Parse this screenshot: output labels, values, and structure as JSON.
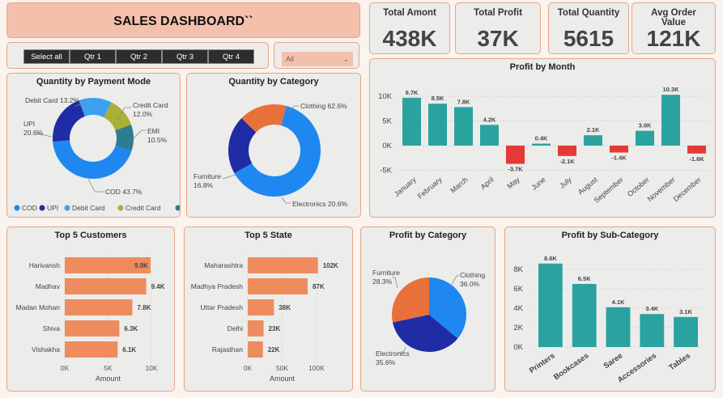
{
  "dashboard": {
    "title": "SALES DASHBOARD``"
  },
  "kpis": [
    {
      "label": "Total Amont",
      "value": "438K"
    },
    {
      "label": "Total Profit",
      "value": "37K"
    },
    {
      "label": "Total Quantity",
      "value": "5615"
    },
    {
      "label": "Avg Order Value",
      "value": "121K"
    }
  ],
  "filters": {
    "quarter_buttons": [
      "Select all",
      "Qtr 1",
      "Qtr 2",
      "Qtr 3",
      "Qtr 4"
    ],
    "dropdown_value": "All"
  },
  "colors": {
    "accent": "#f4c0ac",
    "border": "#e3a689",
    "teal": "#2aa3a0",
    "red": "#e53935",
    "salmon": "#ef8c5e",
    "blue": "#1e88f0",
    "navy": "#1f2ca5",
    "orange": "#e8703a",
    "olive": "#a9b035",
    "slate": "#2f7b91"
  },
  "chart_data": [
    {
      "id": "payment",
      "type": "pie",
      "title": "Quantity by Payment Mode",
      "categories": [
        "COD",
        "UPI",
        "Debit Card",
        "Credit Card",
        "EMI"
      ],
      "values": [
        43.7,
        20.6,
        13.2,
        12.0,
        10.5
      ],
      "labels": [
        "COD 43.7%",
        "UPI\n20.6%",
        "Debit Card 13.2%",
        "Credit Card\n12.0%",
        "EMI\n10.5%"
      ],
      "legend": "bottom"
    },
    {
      "id": "category",
      "type": "pie",
      "title": "Quantity by Category",
      "categories": [
        "Clothing",
        "Electronics",
        "Furniture"
      ],
      "values": [
        62.6,
        20.6,
        16.8
      ],
      "labels": [
        "Clothing 62.6%",
        "Electronics 20.6%",
        "Furniture\n16.8%"
      ]
    },
    {
      "id": "month",
      "type": "bar",
      "title": "Profit by Month",
      "categories": [
        "January",
        "February",
        "March",
        "April",
        "May",
        "June",
        "July",
        "August",
        "September",
        "October",
        "November",
        "December"
      ],
      "values": [
        9.7,
        8.5,
        7.8,
        4.2,
        -3.7,
        0.4,
        -2.1,
        2.1,
        -1.4,
        3.0,
        10.3,
        -1.6
      ],
      "value_labels": [
        "9.7K",
        "8.5K",
        "7.8K",
        "4.2K",
        "-3.7K",
        "0.4K",
        "-2.1K",
        "2.1K",
        "-1.4K",
        "3.0K",
        "10.3K",
        "-1.6K"
      ],
      "yticks": [
        "10K",
        "5K",
        "0K",
        "-5K"
      ],
      "ylim": [
        -5,
        10
      ]
    },
    {
      "id": "customers",
      "type": "bar",
      "title": "Top 5 Customers",
      "categories": [
        "Harivansh",
        "Madhav",
        "Madan Mohan",
        "Shiva",
        "Vishakha"
      ],
      "values": [
        9.9,
        9.4,
        7.8,
        6.3,
        6.1
      ],
      "value_labels": [
        "9.9K",
        "9.4K",
        "7.8K",
        "6.3K",
        "6.1K"
      ],
      "xticks": [
        "0K",
        "5K",
        "10K"
      ],
      "xlabel": "Amount",
      "xlim": [
        0,
        10
      ]
    },
    {
      "id": "states",
      "type": "bar",
      "title": "Top 5 State",
      "categories": [
        "Maharashtra",
        "Madhya Pradesh",
        "Uttar Pradesh",
        "Delhi",
        "Rajasthan"
      ],
      "values": [
        102,
        87,
        38,
        23,
        22
      ],
      "value_labels": [
        "102K",
        "87K",
        "38K",
        "23K",
        "22K"
      ],
      "xticks": [
        "0K",
        "50K",
        "100K"
      ],
      "xlabel": "Amount",
      "xlim": [
        0,
        100
      ]
    },
    {
      "id": "profitcat",
      "type": "pie",
      "title": "Profit by Category",
      "categories": [
        "Clothing",
        "Electronics",
        "Furniture"
      ],
      "values": [
        36.0,
        35.6,
        28.3
      ],
      "labels": [
        "Clothing\n36.0%",
        "Electronics\n35.6%",
        "Furniture\n28.3%"
      ]
    },
    {
      "id": "subcat",
      "type": "bar",
      "title": "Profit by Sub-Category",
      "categories": [
        "Printers",
        "Bookcases",
        "Saree",
        "Accessories",
        "Tables"
      ],
      "values": [
        8.6,
        6.5,
        4.1,
        3.4,
        3.1
      ],
      "value_labels": [
        "8.6K",
        "6.5K",
        "4.1K",
        "3.4K",
        "3.1K"
      ],
      "yticks": [
        "8K",
        "6K",
        "4K",
        "2K",
        "0K"
      ],
      "ylim": [
        0,
        8
      ]
    }
  ]
}
